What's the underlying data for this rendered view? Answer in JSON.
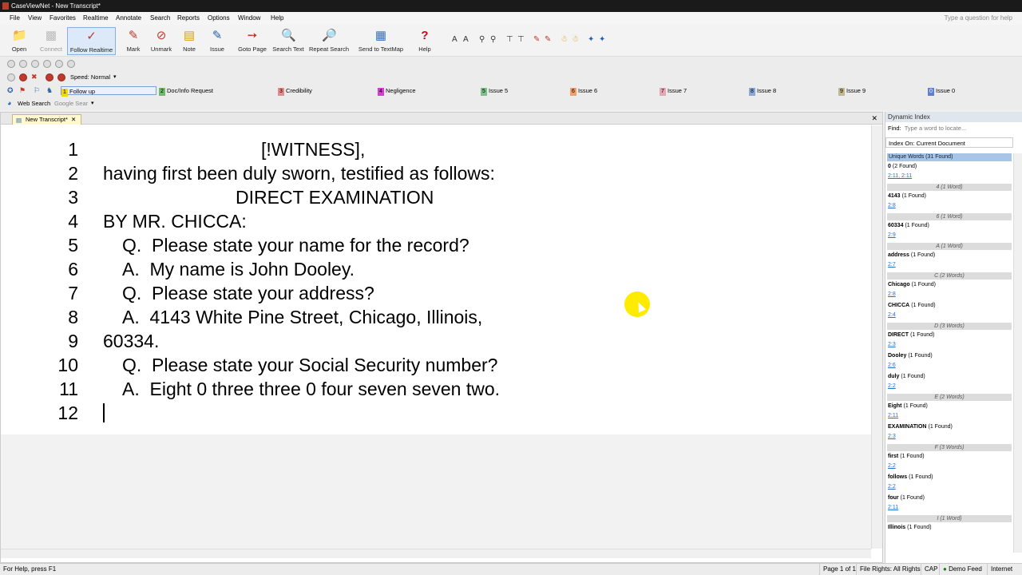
{
  "app": {
    "title": "CaseViewNet - New Transcript*"
  },
  "menu": {
    "items": [
      "File",
      "View",
      "Favorites",
      "Realtime",
      "Annotate",
      "Search",
      "Reports",
      "Options",
      "Window",
      "Help"
    ],
    "help_search_placeholder": "Type a question for help"
  },
  "toolbar": {
    "buttons": [
      {
        "label": "Open",
        "icon": "folder-icon"
      },
      {
        "label": "Connect",
        "icon": "connect-icon"
      },
      {
        "label": "Follow Realtime",
        "icon": "follow-realtime-icon"
      },
      {
        "label": "Mark",
        "icon": "mark-icon"
      },
      {
        "label": "Unmark",
        "icon": "unmark-icon"
      },
      {
        "label": "Note",
        "icon": "note-icon"
      },
      {
        "label": "Issue",
        "icon": "issue-icon"
      },
      {
        "label": "Goto Page",
        "icon": "goto-page-icon"
      },
      {
        "label": "Search Text",
        "icon": "search-text-icon"
      },
      {
        "label": "Repeat Search",
        "icon": "repeat-search-icon"
      },
      {
        "label": "Send to TextMap",
        "icon": "textmap-icon"
      },
      {
        "label": "Help",
        "icon": "help-icon"
      }
    ]
  },
  "playback": {
    "speed_label": "Speed: Normal"
  },
  "issues": [
    {
      "num": "1",
      "label": "Follow up",
      "color": "#f5d800"
    },
    {
      "num": "2",
      "label": "Doc/Info Request",
      "color": "#6dbb6d"
    },
    {
      "num": "3",
      "label": "Credibility",
      "color": "#e98a8a"
    },
    {
      "num": "4",
      "label": "Negligence",
      "color": "#d63cd6"
    },
    {
      "num": "5",
      "label": "Issue 5",
      "color": "#7cc08c"
    },
    {
      "num": "6",
      "label": "Issue 6",
      "color": "#f2a06a"
    },
    {
      "num": "7",
      "label": "Issue 7",
      "color": "#e8a5b5"
    },
    {
      "num": "8",
      "label": "Issue 8",
      "color": "#8aa8d8"
    },
    {
      "num": "9",
      "label": "Issue 9",
      "color": "#c2b78f"
    },
    {
      "num": "0",
      "label": "Issue 0",
      "color": "#5f7fcf"
    }
  ],
  "websearch": {
    "label": "Web Search",
    "engine": "Google Sear"
  },
  "document": {
    "tab_label": "New Transcript*",
    "lines": [
      {
        "n": "1",
        "text": "[!WITNESS],"
      },
      {
        "n": "2",
        "text": "having first been duly sworn, testified as follows:"
      },
      {
        "n": "3",
        "text": "DIRECT EXAMINATION"
      },
      {
        "n": "4",
        "text": "BY MR. CHICCA:"
      },
      {
        "n": "5",
        "text": "Q.  Please state your name for the record?"
      },
      {
        "n": "6",
        "text": "A.  My name is John Dooley."
      },
      {
        "n": "7",
        "text": "Q.  Please state your address?"
      },
      {
        "n": "8",
        "text": "A.  4143 White Pine Street, Chicago, Illinois,"
      },
      {
        "n": "9",
        "text": "60334."
      },
      {
        "n": "10",
        "text": "Q.  Please state your Social Security number?"
      },
      {
        "n": "11",
        "text": "A.  Eight 0 three three 0 four seven seven two."
      },
      {
        "n": "12",
        "text": ""
      }
    ]
  },
  "dynamic_index": {
    "title": "Dynamic Index",
    "find_label": "Find:",
    "find_placeholder": "Type a word to locate...",
    "index_on": "Index On:  Current Document",
    "unique_words": "Unique Words (31 Found)",
    "entries": [
      {
        "kind": "word",
        "word": "0",
        "count": "(2 Found)"
      },
      {
        "kind": "ref",
        "text": "2:11, 2:11"
      },
      {
        "kind": "group",
        "text": "4 (1 Word)"
      },
      {
        "kind": "word",
        "word": "4143",
        "count": "(1 Found)"
      },
      {
        "kind": "ref",
        "text": "2:8"
      },
      {
        "kind": "group",
        "text": "6 (1 Word)"
      },
      {
        "kind": "word",
        "word": "60334",
        "count": "(1 Found)"
      },
      {
        "kind": "ref",
        "text": "2:9"
      },
      {
        "kind": "group",
        "text": "A (1 Word)"
      },
      {
        "kind": "word",
        "word": "address",
        "count": "(1 Found)"
      },
      {
        "kind": "ref",
        "text": "2:7"
      },
      {
        "kind": "group",
        "text": "C (2 Words)"
      },
      {
        "kind": "word",
        "word": "Chicago",
        "count": "(1 Found)"
      },
      {
        "kind": "ref",
        "text": "2:8"
      },
      {
        "kind": "word",
        "word": "CHICCA",
        "count": "(1 Found)"
      },
      {
        "kind": "ref",
        "text": "2:4"
      },
      {
        "kind": "group",
        "text": "D (3 Words)"
      },
      {
        "kind": "word",
        "word": "DIRECT",
        "count": "(1 Found)"
      },
      {
        "kind": "ref",
        "text": "2:3"
      },
      {
        "kind": "word",
        "word": "Dooley",
        "count": "(1 Found)"
      },
      {
        "kind": "ref",
        "text": "2:6"
      },
      {
        "kind": "word",
        "word": "duly",
        "count": "(1 Found)"
      },
      {
        "kind": "ref",
        "text": "2:2"
      },
      {
        "kind": "group",
        "text": "E (2 Words)"
      },
      {
        "kind": "word",
        "word": "Eight",
        "count": "(1 Found)"
      },
      {
        "kind": "ref",
        "text": "2:11"
      },
      {
        "kind": "word",
        "word": "EXAMINATION",
        "count": "(1 Found)"
      },
      {
        "kind": "ref",
        "text": "2:3"
      },
      {
        "kind": "group",
        "text": "F (3 Words)"
      },
      {
        "kind": "word",
        "word": "first",
        "count": "(1 Found)"
      },
      {
        "kind": "ref",
        "text": "2:2"
      },
      {
        "kind": "word",
        "word": "follows",
        "count": "(1 Found)"
      },
      {
        "kind": "ref",
        "text": "2:2"
      },
      {
        "kind": "word",
        "word": "four",
        "count": "(1 Found)"
      },
      {
        "kind": "ref",
        "text": "2:11"
      },
      {
        "kind": "group",
        "text": "I (1 Word)"
      },
      {
        "kind": "word",
        "word": "Illinois",
        "count": "(1 Found)"
      }
    ]
  },
  "status": {
    "help": "For Help, press F1",
    "page": "Page 1 of 1",
    "rights": "File Rights: All Rights",
    "cap": "CAP",
    "feed": "Demo Feed",
    "internet": "Internet"
  }
}
